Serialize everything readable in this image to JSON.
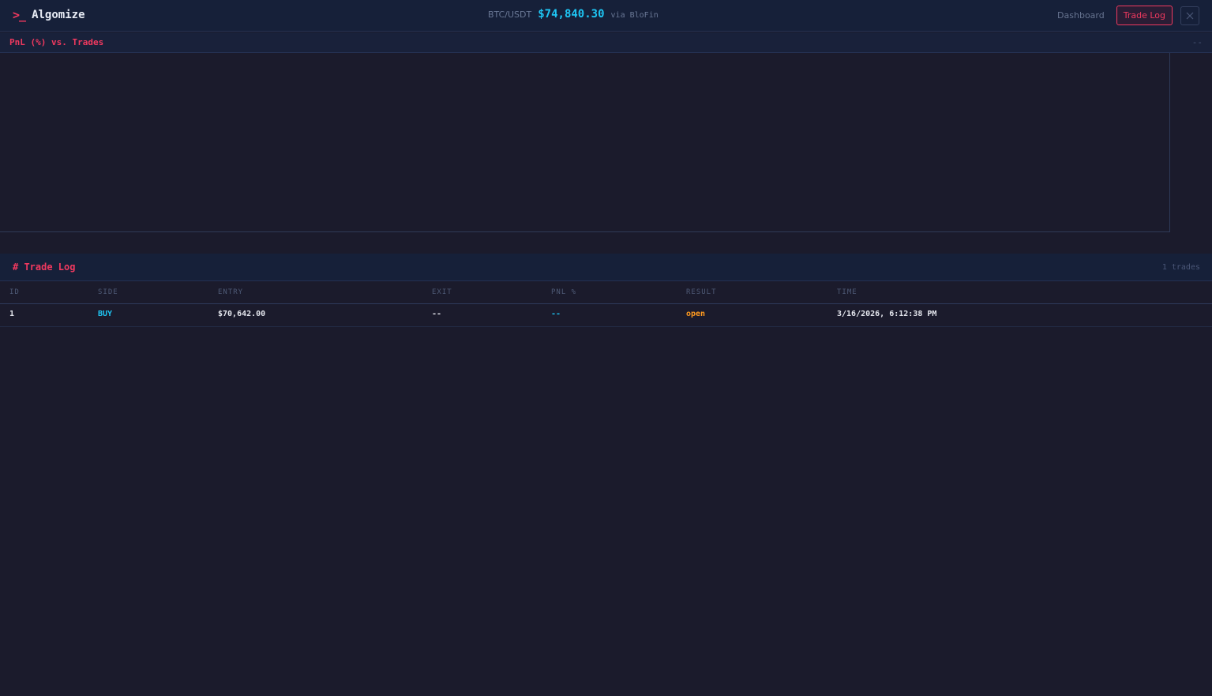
{
  "header": {
    "brand_prompt": ">_",
    "brand_name": "Algomize",
    "ticker": {
      "pair": "BTC/USDT",
      "price": "$74,840.30",
      "source": "via BloFin"
    },
    "nav": {
      "dashboard_label": "Dashboard",
      "trade_log_label": "Trade Log",
      "close_icon": "close-icon"
    }
  },
  "chart_panel": {
    "title": "PnL (%) vs. Trades",
    "value": "--"
  },
  "trade_log": {
    "title": "# Trade Log",
    "count": "1 trades",
    "columns": [
      "ID",
      "SIDE",
      "ENTRY",
      "EXIT",
      "PNL %",
      "RESULT",
      "TIME"
    ],
    "rows": [
      {
        "id": "1",
        "side": "BUY",
        "entry": "$70,642.00",
        "exit": "--",
        "pnl": "--",
        "result": "open",
        "time": "3/16/2026, 6:12:38 PM"
      }
    ]
  },
  "colors": {
    "accent": "#f0395f",
    "price": "#1ec5f3",
    "open_status": "#ff9a1f",
    "background": "#1b1b2c"
  }
}
